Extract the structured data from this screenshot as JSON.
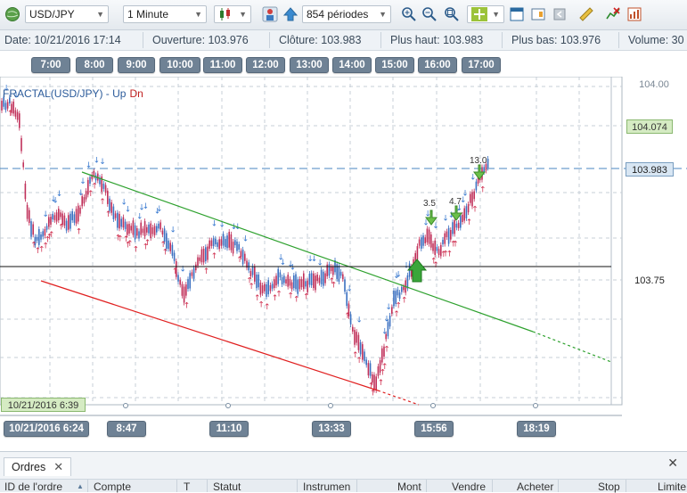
{
  "toolbar": {
    "symbol": "USD/JPY",
    "timeframe": "1 Minute",
    "periods": "854 périodes"
  },
  "info": {
    "date": "Date: 10/21/2016 17:14",
    "open": "Ouverture: 103.976",
    "close": "Clôture: 103.983",
    "high": "Plus haut: 103.983",
    "low": "Plus bas: 103.976",
    "volume": "Volume: 30"
  },
  "time_axis_top": [
    "7:00",
    "8:00",
    "9:00",
    "10:00",
    "11:00",
    "12:00",
    "13:00",
    "14:00",
    "15:00",
    "16:00",
    "17:00"
  ],
  "time_axis_bottom": [
    "10/21/2016  6:24",
    "8:47",
    "11:10",
    "13:33",
    "15:56",
    "18:19"
  ],
  "indicator": {
    "name": "FRACTAL(USD/JPY) - ",
    "up": "Up",
    "dn": "Dn"
  },
  "price_labels": {
    "high_tag": "104.074",
    "current": "103.983",
    "level": "103.75",
    "hidden": "104.00"
  },
  "date_tag": "10/21/2016 6:39",
  "annotations": {
    "a1": "3.5",
    "a2": "4.7",
    "a3": "13.0"
  },
  "colors": {
    "up_line": "#2ea12e",
    "down_line": "#e02020",
    "candle_up": "#3a6fc0",
    "candle_down": "#c0305a"
  },
  "bottom": {
    "tab_label": "Ordres",
    "columns": [
      "ID de l'ordre",
      "Compte",
      "T",
      "Statut",
      "Instrumen",
      "Mont",
      "Vendre",
      "Acheter",
      "Stop",
      "Limite"
    ]
  }
}
